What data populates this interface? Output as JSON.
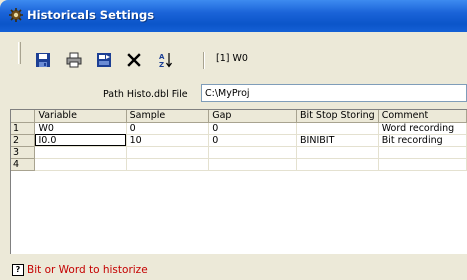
{
  "window": {
    "title": "Historicals Settings"
  },
  "toolbar": {
    "buttons": [
      {
        "icon": "save-icon"
      },
      {
        "icon": "print-icon"
      },
      {
        "icon": "export-icon"
      },
      {
        "icon": "delete-icon"
      },
      {
        "icon": "sort-az-icon"
      }
    ],
    "selection_status": "[1] W0"
  },
  "path": {
    "label": "Path Histo.dbl File",
    "value": "C:\\MyProj"
  },
  "grid": {
    "columns": [
      "Variable",
      "Sample",
      "Gap",
      "Bit Stop Storing",
      "Comment"
    ],
    "row_numbers": [
      "1",
      "2",
      "3",
      "4"
    ],
    "rows": [
      [
        "W0",
        "0",
        "0",
        "",
        "Word recording"
      ],
      [
        "I0.0",
        "10",
        "0",
        "BINIBIT",
        "Bit recording"
      ],
      [
        "",
        "",
        "",
        "",
        ""
      ],
      [
        "",
        "",
        "",
        "",
        ""
      ]
    ]
  },
  "status": {
    "icon": "help-icon",
    "text": "Bit or Word to historize"
  },
  "colors": {
    "title_bar": "#1a63d8",
    "status_text": "#c40000",
    "background": "#ece9d8"
  }
}
